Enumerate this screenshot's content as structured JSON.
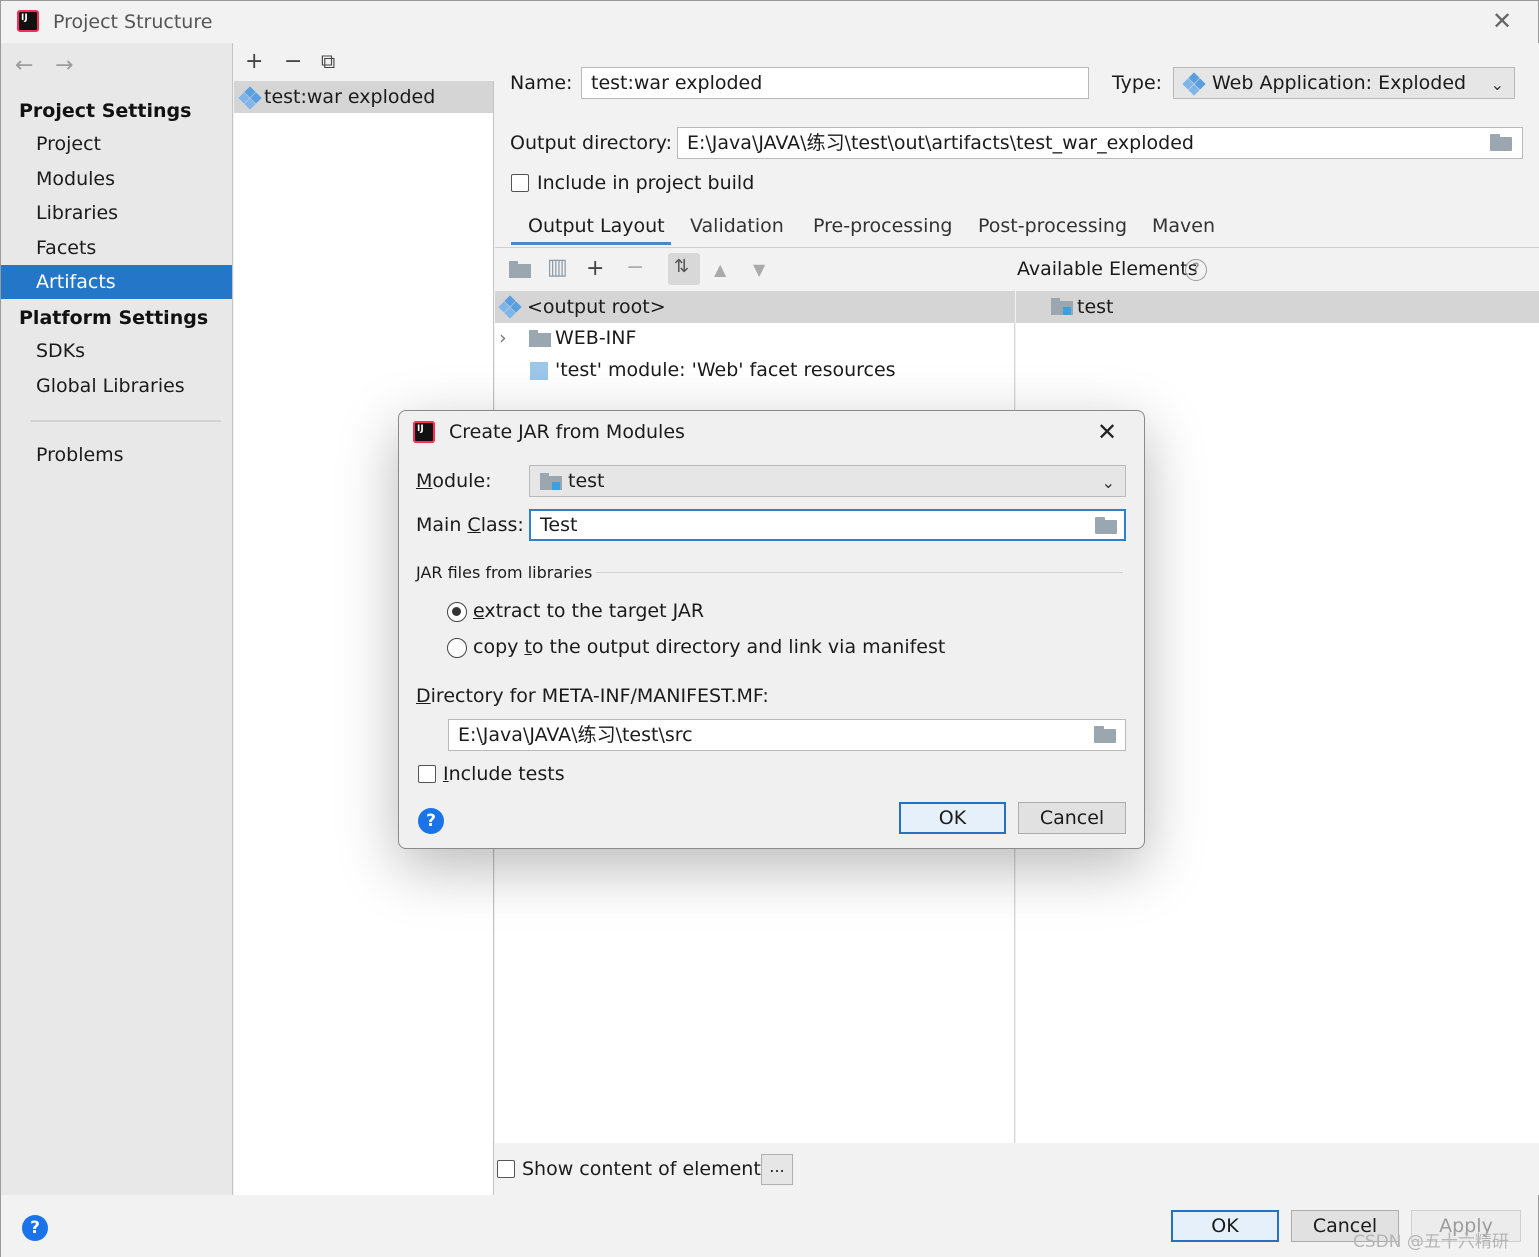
{
  "window": {
    "title": "Project Structure"
  },
  "sidebar": {
    "project_settings_header": "Project Settings",
    "project_items": [
      "Project",
      "Modules",
      "Libraries",
      "Facets",
      "Artifacts"
    ],
    "selected_item": "Artifacts",
    "platform_settings_header": "Platform Settings",
    "platform_items": [
      "SDKs",
      "Global Libraries"
    ],
    "problems": "Problems"
  },
  "artifacts": {
    "items": [
      "test:war exploded"
    ]
  },
  "artifact": {
    "name_label": "Name:",
    "name_value": "test:war exploded",
    "type_label": "Type:",
    "type_value": "Web Application: Exploded",
    "output_label": "Output directory:",
    "output_value": "E:\\Java\\JAVA\\练习\\test\\out\\artifacts\\test_war_exploded",
    "include_build_label": "Include in project build",
    "include_build_checked": false
  },
  "tabs": [
    "Output Layout",
    "Validation",
    "Pre-processing",
    "Post-processing",
    "Maven"
  ],
  "active_tab": "Output Layout",
  "layout": {
    "available_label": "Available Elements",
    "tree": {
      "root": "<output root>",
      "webinf": "WEB-INF",
      "resources": "'test' module: 'Web' facet resources"
    },
    "available": [
      "test"
    ],
    "show_content_label": "Show content of elements",
    "dots": "..."
  },
  "footer": {
    "ok": "OK",
    "cancel": "Cancel",
    "apply": "Apply"
  },
  "watermark": "CSDN @五十六精研",
  "dialog": {
    "title": "Create JAR from Modules",
    "module_label_u": "M",
    "module_label_rest": "odule:",
    "module_value": "test",
    "main_class_label_a": "Main ",
    "main_class_label_u": "C",
    "main_class_label_b": "lass:",
    "main_class_value": "Test",
    "jar_group": "JAR files from libraries",
    "radio_extract_u": "e",
    "radio_extract_rest": "xtract to the target JAR",
    "radio_copy_a": "copy ",
    "radio_copy_u": "t",
    "radio_copy_b": "o the output directory and link via manifest",
    "selected_radio": "extract",
    "manifest_label_u": "D",
    "manifest_label_rest": "irectory for META-INF/MANIFEST.MF:",
    "manifest_value": "E:\\Java\\JAVA\\练习\\test\\src",
    "include_tests_u": "I",
    "include_tests_rest": "nclude tests",
    "include_tests_checked": false,
    "ok": "OK",
    "cancel": "Cancel"
  }
}
